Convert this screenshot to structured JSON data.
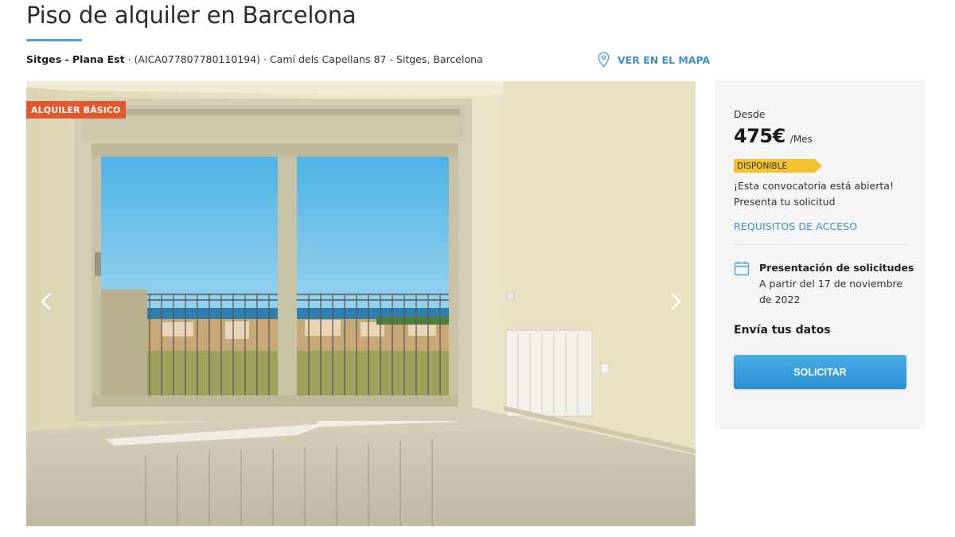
{
  "header": {
    "title": "Piso de alquiler en Barcelona",
    "location_name": "Sitges - Plana Est",
    "location_rest": " · (AICA077807780110194) · Camí dels Capellans 87 - Sitges, Barcelona",
    "map_link": "VER EN EL MAPA",
    "map_icon": "map-pin-icon",
    "accent_color": "#4aa3dc"
  },
  "gallery": {
    "badge": "ALQUILER BÁSICO",
    "badge_color": "#e1582c",
    "prev_icon": "chevron-left-icon",
    "next_icon": "chevron-right-icon"
  },
  "sidebar": {
    "from_label": "Desde",
    "price": "475€",
    "period": "/Mes",
    "status": "DISPONIBLE",
    "status_color": "#f2c230",
    "open_message": "¡Esta convocatoria está abierta! Presenta tu solicitud",
    "requirements_link": "REQUISITOS DE ACCESO",
    "calendar_icon": "calendar-icon",
    "application_title": "Presentación de solicitudes",
    "application_date": "A partir del 17 de noviembre de 2022",
    "send_data_label": "Envía tus datos",
    "apply_button": "SOLICITAR",
    "button_color": "#3a9fde"
  }
}
